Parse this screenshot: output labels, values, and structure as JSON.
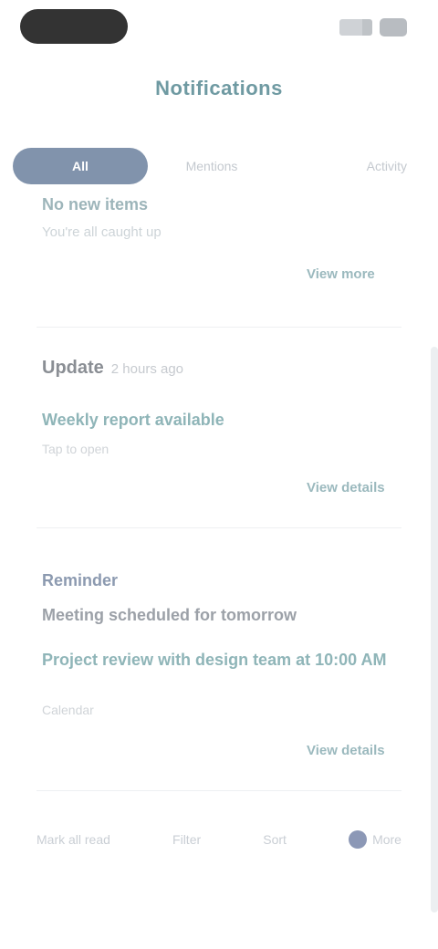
{
  "status_bar": {
    "signal_icon": "signal-icon",
    "battery_icon": "battery-icon"
  },
  "page": {
    "title": "Notifications"
  },
  "tabs": [
    {
      "label": "All"
    },
    {
      "label": "Mentions"
    },
    {
      "label": "Activity"
    }
  ],
  "top_section": {
    "subtitle": "No new items",
    "note": "You're all caught up",
    "link": "View more"
  },
  "cards": [
    {
      "title": "Update",
      "meta": "2 hours ago",
      "line": "Weekly report available",
      "small": "Tap to open",
      "link": "View details"
    },
    {
      "tag": "Reminder",
      "dark": "Meeting scheduled for tomorrow",
      "line": "Project review with design team at 10:00 AM",
      "small": "Calendar",
      "link": "View details"
    }
  ],
  "bottom_bar": [
    {
      "label": "Mark all read"
    },
    {
      "label": "Filter"
    },
    {
      "label": "Sort"
    },
    {
      "label": "More",
      "icon": "user-icon"
    }
  ],
  "colors": {
    "accent": "#8193ac",
    "link": "#9bb9be"
  }
}
